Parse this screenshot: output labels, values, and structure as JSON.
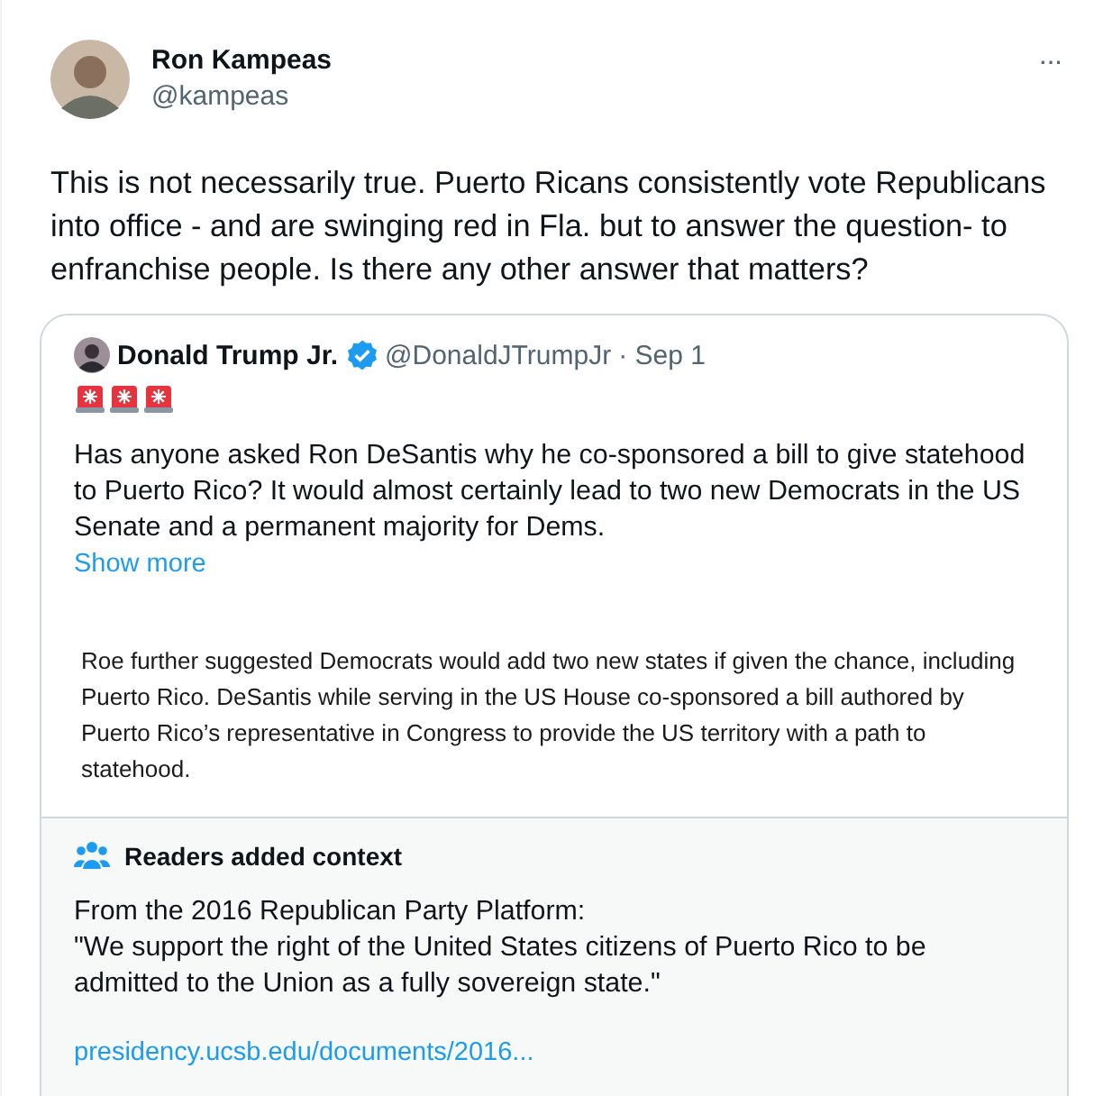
{
  "tweet": {
    "author": {
      "name": "Ron Kampeas",
      "handle": "@kampeas"
    },
    "more": "···",
    "text": "This is not necessarily true. Puerto Ricans consistently vote Republicans into office - and are swinging red in Fla. but to answer the question- to enfranchise people. Is there any other answer that matters?",
    "quote": {
      "author": {
        "name": "Donald Trump Jr.",
        "verified": true,
        "handle": "@DonaldJTrumpJr",
        "date": "· Sep 1"
      },
      "text": "Has anyone asked Ron DeSantis why he co-sponsored a bill to give statehood to Puerto Rico? It would almost certainly lead to two new Democrats in the US Senate and a permanent majority for Dems.",
      "show_more": "Show more",
      "image_text": "Roe further suggested Democrats would add two new states if given the chance, including Puerto Rico. DeSantis while serving in the US House co-sponsored a bill authored by Puerto Rico’s representative in Congress to provide the US territory with a path to statehood."
    },
    "context": {
      "title": "Readers added context",
      "lines": [
        "From the 2016 Republican Party Platform:",
        "\"We support the right of the United States citizens of Puerto Rico to be admitted to the Union as a fully sovereign state.\""
      ],
      "link": "presidency.ucsb.edu/documents/2016..."
    }
  }
}
